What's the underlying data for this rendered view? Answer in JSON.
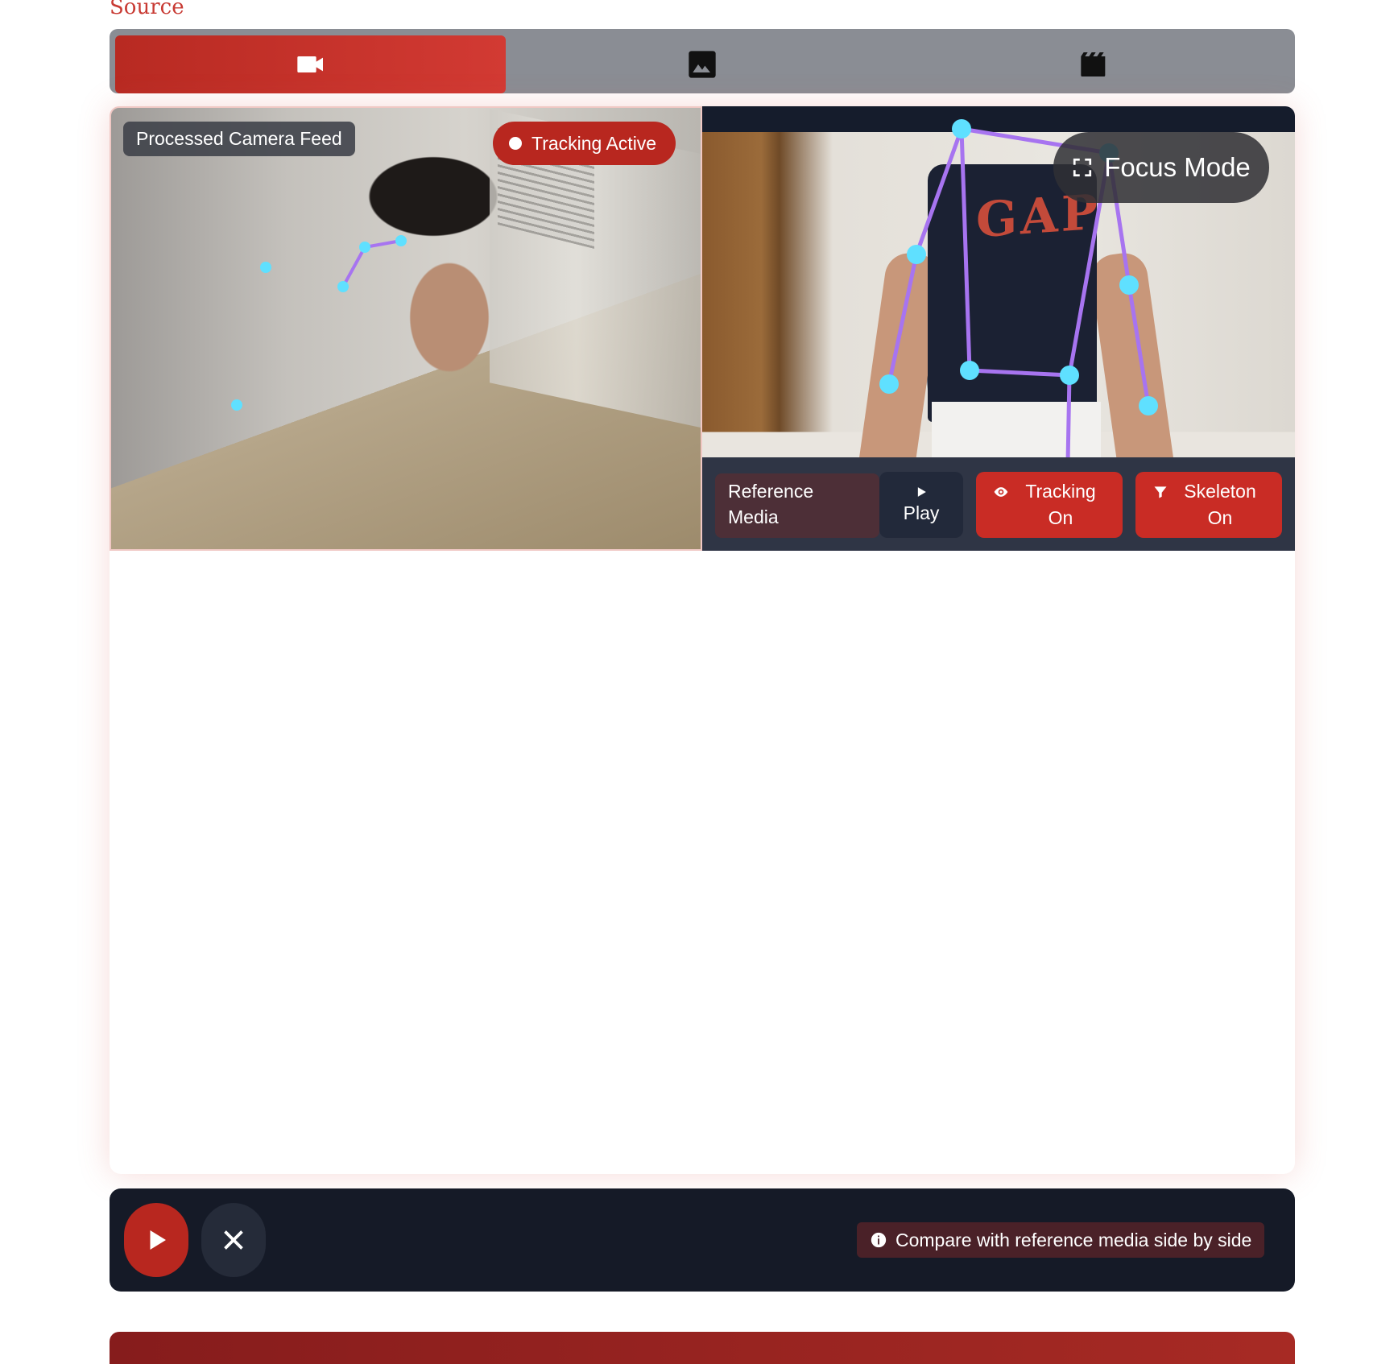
{
  "source": {
    "label": "Source"
  },
  "tabs": [
    {
      "icon": "video-camera-icon",
      "active": true
    },
    {
      "icon": "image-icon",
      "active": false
    },
    {
      "icon": "film-clapper-icon",
      "active": false
    }
  ],
  "camera_feed": {
    "title": "Processed Camera Feed",
    "status": "Tracking Active"
  },
  "reference": {
    "focus_label": "Focus Mode",
    "label": "Reference Media",
    "play_label": "Play",
    "tracking_label": "Tracking On",
    "skeleton_label": "Skeleton On"
  },
  "bottom_bar": {
    "info_text": "Compare with reference media side by side"
  },
  "colors": {
    "accent": "#c92c25",
    "dark_panel": "#151a27",
    "keypoint": "#5fe0ff",
    "skeleton_line": "#a774f0"
  }
}
